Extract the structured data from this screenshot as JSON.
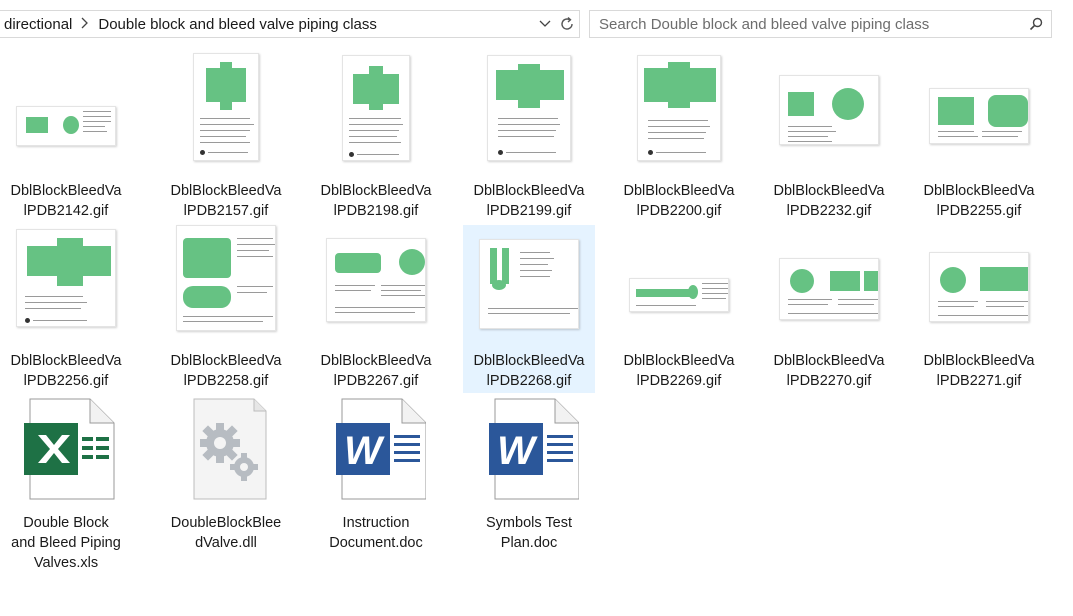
{
  "addressbar": {
    "breadcrumbs": [
      "directional",
      "Double block and bleed valve piping class"
    ],
    "search_placeholder": "Search Double block and bleed valve piping class"
  },
  "files": [
    {
      "name": "DblBlockBleedValPDB2142.gif",
      "line1": "DblBlockBleedVa",
      "line2": "lPDB2142.gif",
      "type": "gif"
    },
    {
      "name": "DblBlockBleedValPDB2157.gif",
      "line1": "DblBlockBleedVa",
      "line2": "lPDB2157.gif",
      "type": "gif"
    },
    {
      "name": "DblBlockBleedValPDB2198.gif",
      "line1": "DblBlockBleedVa",
      "line2": "lPDB2198.gif",
      "type": "gif"
    },
    {
      "name": "DblBlockBleedValPDB2199.gif",
      "line1": "DblBlockBleedVa",
      "line2": "lPDB2199.gif",
      "type": "gif"
    },
    {
      "name": "DblBlockBleedValPDB2200.gif",
      "line1": "DblBlockBleedVa",
      "line2": "lPDB2200.gif",
      "type": "gif"
    },
    {
      "name": "DblBlockBleedValPDB2232.gif",
      "line1": "DblBlockBleedVa",
      "line2": "lPDB2232.gif",
      "type": "gif"
    },
    {
      "name": "DblBlockBleedValPDB2255.gif",
      "line1": "DblBlockBleedVa",
      "line2": "lPDB2255.gif",
      "type": "gif"
    },
    {
      "name": "DblBlockBleedValPDB2256.gif",
      "line1": "DblBlockBleedVa",
      "line2": "lPDB2256.gif",
      "type": "gif"
    },
    {
      "name": "DblBlockBleedValPDB2258.gif",
      "line1": "DblBlockBleedVa",
      "line2": "lPDB2258.gif",
      "type": "gif"
    },
    {
      "name": "DblBlockBleedValPDB2267.gif",
      "line1": "DblBlockBleedVa",
      "line2": "lPDB2267.gif",
      "type": "gif"
    },
    {
      "name": "DblBlockBleedValPDB2268.gif",
      "line1": "DblBlockBleedVa",
      "line2": "lPDB2268.gif",
      "type": "gif",
      "selected": true
    },
    {
      "name": "DblBlockBleedValPDB2269.gif",
      "line1": "DblBlockBleedVa",
      "line2": "lPDB2269.gif",
      "type": "gif"
    },
    {
      "name": "DblBlockBleedValPDB2270.gif",
      "line1": "DblBlockBleedVa",
      "line2": "lPDB2270.gif",
      "type": "gif"
    },
    {
      "name": "DblBlockBleedValPDB2271.gif",
      "line1": "DblBlockBleedVa",
      "line2": "lPDB2271.gif",
      "type": "gif"
    },
    {
      "name": "Double Block and Bleed Piping Valves.xls",
      "lines": [
        "Double Block",
        "and Bleed Piping",
        "Valves.xls"
      ],
      "type": "xls",
      "icon": "excel-file-icon"
    },
    {
      "name": "DoubleBlockBleedValve.dll",
      "lines": [
        "DoubleBlockBlee",
        "dValve.dll"
      ],
      "type": "dll",
      "icon": "gear-file-icon"
    },
    {
      "name": "Instruction Document.doc",
      "lines": [
        "Instruction",
        "Document.doc"
      ],
      "type": "doc",
      "icon": "word-file-icon"
    },
    {
      "name": "Symbols Test Plan.doc",
      "lines": [
        "Symbols Test",
        "Plan.doc"
      ],
      "type": "doc",
      "icon": "word-file-icon"
    }
  ],
  "colors": {
    "selection": "#e5f3ff",
    "thumb_green": "#66c283",
    "excel_green": "#1e7145",
    "word_blue": "#2b579a"
  }
}
